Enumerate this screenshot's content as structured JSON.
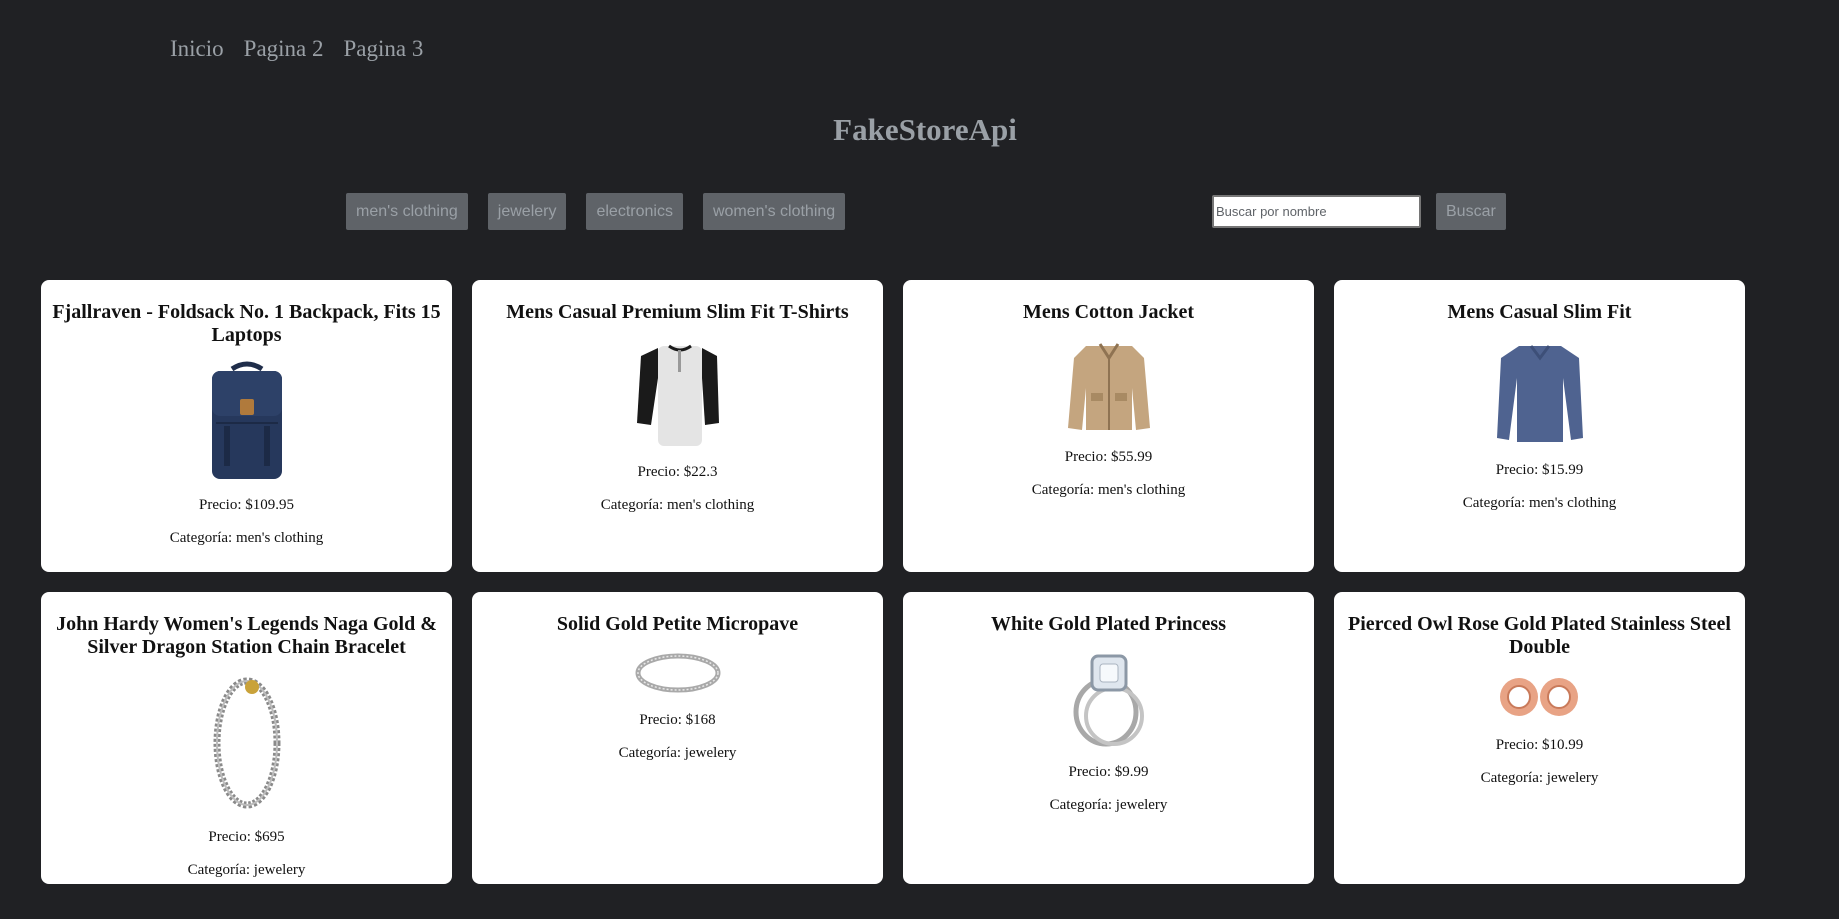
{
  "nav": {
    "items": [
      "Inicio",
      "Pagina 2",
      "Pagina 3"
    ]
  },
  "title": "FakeStoreApi",
  "categories": [
    "men's clothing",
    "jewelery",
    "electronics",
    "women's clothing"
  ],
  "search": {
    "placeholder": "Buscar por nombre",
    "value": "",
    "button": "Buscar"
  },
  "products": [
    {
      "title": "Fjallraven - Foldsack No. 1 Backpack, Fits 15 Laptops",
      "price": "Precio: $109.95",
      "category": "Categoría: men's clothing",
      "icon": "backpack-image"
    },
    {
      "title": "Mens Casual Premium Slim Fit T-Shirts",
      "price": "Precio: $22.3",
      "category": "Categoría: men's clothing",
      "icon": "raglan-tshirt-image"
    },
    {
      "title": "Mens Cotton Jacket",
      "price": "Precio: $55.99",
      "category": "Categoría: men's clothing",
      "icon": "jacket-image"
    },
    {
      "title": "Mens Casual Slim Fit",
      "price": "Precio: $15.99",
      "category": "Categoría: men's clothing",
      "icon": "longsleeve-shirt-image"
    },
    {
      "title": "John Hardy Women's Legends Naga Gold & Silver Dragon Station Chain Bracelet",
      "price": "Precio: $695",
      "category": "Categoría: jewelery",
      "icon": "bracelet-image"
    },
    {
      "title": "Solid Gold Petite Micropave",
      "price": "Precio: $168",
      "category": "Categoría: jewelery",
      "icon": "ring-image"
    },
    {
      "title": "White Gold Plated Princess",
      "price": "Precio: $9.99",
      "category": "Categoría: jewelery",
      "icon": "diamond-ring-image"
    },
    {
      "title": "Pierced Owl Rose Gold Plated Stainless Steel Double",
      "price": "Precio: $10.99",
      "category": "Categoría: jewelery",
      "icon": "ear-plugs-image"
    }
  ],
  "colors": {
    "background": "#202124",
    "muted_text": "#9aa0a6",
    "button_bg": "#5f6368",
    "card_bg": "#ffffff"
  }
}
